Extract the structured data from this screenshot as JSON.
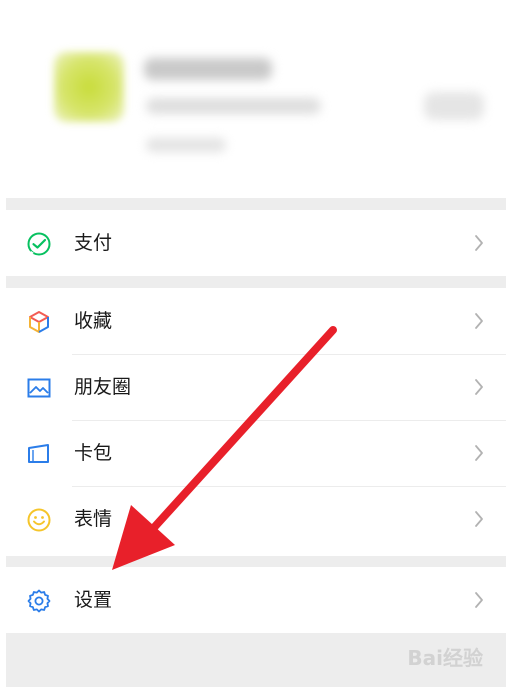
{
  "menu": {
    "pay": {
      "label": "支付",
      "icon": "pay-check-icon",
      "color": "#07c160"
    },
    "favorites": {
      "label": "收藏",
      "icon": "cube-icon"
    },
    "moments": {
      "label": "朋友圈",
      "icon": "picture-icon",
      "color": "#2b7de9"
    },
    "cards": {
      "label": "卡包",
      "icon": "card-wallet-icon",
      "color": "#2b7de9"
    },
    "stickers": {
      "label": "表情",
      "icon": "smile-icon",
      "color": "#f5c52a"
    },
    "settings": {
      "label": "设置",
      "icon": "gear-icon",
      "color": "#2b7de9"
    }
  },
  "annotation": {
    "arrow_color": "#e8202a"
  },
  "watermark": {
    "text": "Bai经验"
  }
}
